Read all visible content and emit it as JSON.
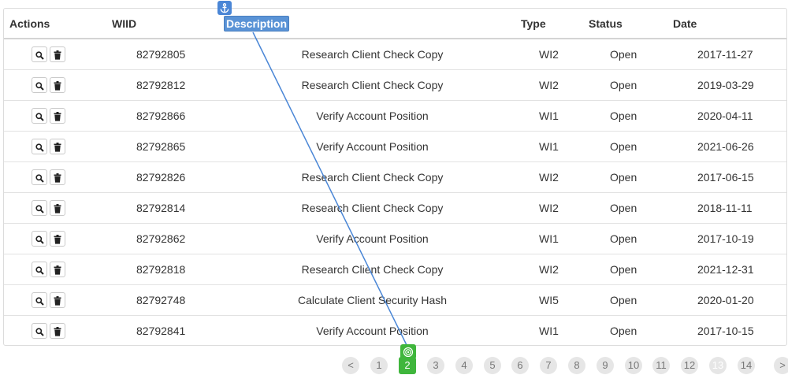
{
  "table": {
    "headers": {
      "actions": "Actions",
      "wiid": "WIID",
      "description": "Description",
      "type": "Type",
      "status": "Status",
      "date": "Date"
    },
    "rows": [
      {
        "wiid": "82792805",
        "description": "Research Client Check Copy",
        "type": "WI2",
        "status": "Open",
        "date": "2017-11-27"
      },
      {
        "wiid": "82792812",
        "description": "Research Client Check Copy",
        "type": "WI2",
        "status": "Open",
        "date": "2019-03-29"
      },
      {
        "wiid": "82792866",
        "description": "Verify Account Position",
        "type": "WI1",
        "status": "Open",
        "date": "2020-04-11"
      },
      {
        "wiid": "82792865",
        "description": "Verify Account Position",
        "type": "WI1",
        "status": "Open",
        "date": "2021-06-26"
      },
      {
        "wiid": "82792826",
        "description": "Research Client Check Copy",
        "type": "WI2",
        "status": "Open",
        "date": "2017-06-15"
      },
      {
        "wiid": "82792814",
        "description": "Research Client Check Copy",
        "type": "WI2",
        "status": "Open",
        "date": "2018-11-11"
      },
      {
        "wiid": "82792862",
        "description": "Verify Account Position",
        "type": "WI1",
        "status": "Open",
        "date": "2017-10-19"
      },
      {
        "wiid": "82792818",
        "description": "Research Client Check Copy",
        "type": "WI2",
        "status": "Open",
        "date": "2021-12-31"
      },
      {
        "wiid": "82792748",
        "description": "Calculate Client Security Hash",
        "type": "WI5",
        "status": "Open",
        "date": "2020-01-20"
      },
      {
        "wiid": "82792841",
        "description": "Verify Account Position",
        "type": "WI1",
        "status": "Open",
        "date": "2017-10-15"
      }
    ],
    "row_action_icons": [
      "search-icon",
      "trash-icon"
    ]
  },
  "pagination": {
    "prev": "<",
    "next": ">",
    "pages": [
      "1",
      "2",
      "3",
      "4",
      "5",
      "6",
      "7",
      "8",
      "9",
      "10",
      "11",
      "12",
      "13",
      "14"
    ],
    "active_page": "2",
    "faded_page": "13"
  },
  "overlay": {
    "anchor_icon": "anchor-icon",
    "target_icon": "target-icon",
    "anchor_color": "#4a86d6",
    "target_color": "#3fb63c"
  }
}
